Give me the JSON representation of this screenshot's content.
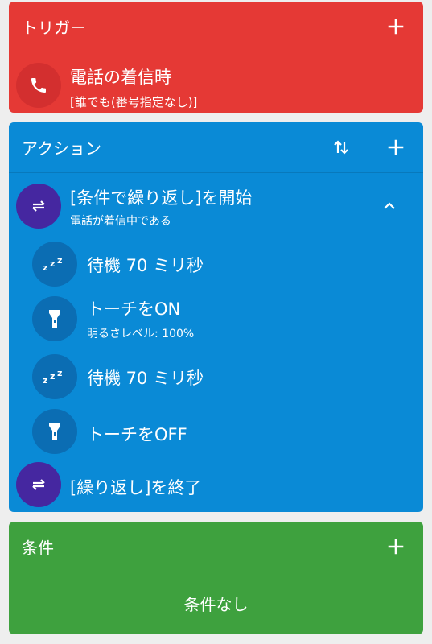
{
  "trigger": {
    "title": "トリガー",
    "colors": {
      "bg": "#e53935",
      "icon_bg": "#d32f2f"
    },
    "items": [
      {
        "icon": "phone-icon",
        "title": "電話の着信時",
        "subtitle": "[誰でも(番号指定なし)]"
      }
    ]
  },
  "actions": {
    "title": "アクション",
    "colors": {
      "bg": "#0a8ad6",
      "loop_icon_bg": "#4527a0",
      "step_icon_bg": "#0b6db3"
    },
    "items": [
      {
        "icon": "repeat-icon",
        "title": "[条件で繰り返し]を開始",
        "subtitle": "電話が着信中である"
      },
      {
        "icon": "sleep-zzz-icon",
        "title": "待機 70 ミリ秒"
      },
      {
        "icon": "flashlight-icon",
        "title": "トーチをON",
        "subtitle": "明るさレベル: 100%"
      },
      {
        "icon": "sleep-zzz-icon",
        "title": "待機 70 ミリ秒"
      },
      {
        "icon": "flashlight-icon",
        "title": "トーチをOFF"
      },
      {
        "icon": "repeat-icon",
        "title": "[繰り返し]を終了"
      }
    ]
  },
  "conditions": {
    "title": "条件",
    "colors": {
      "bg": "#3ea13e"
    },
    "empty_text": "条件なし"
  }
}
